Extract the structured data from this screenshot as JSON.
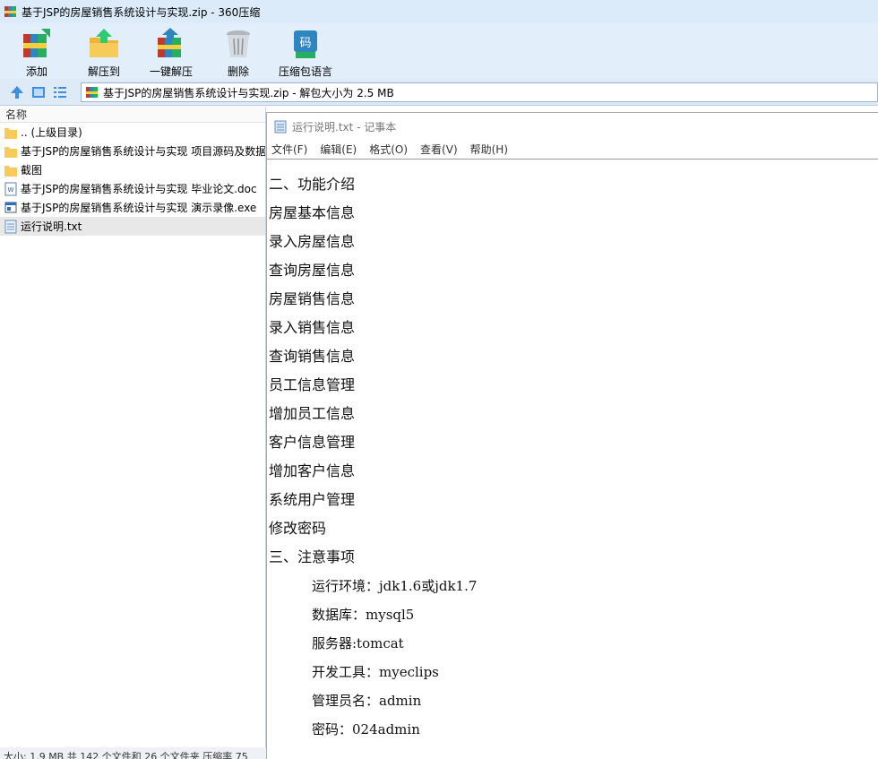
{
  "window": {
    "title": "基于JSP的房屋销售系统设计与实现.zip - 360压缩"
  },
  "toolbar": {
    "buttons": [
      {
        "label": "添加",
        "icon": "add-books-icon"
      },
      {
        "label": "解压到",
        "icon": "extract-to-icon"
      },
      {
        "label": "一键解压",
        "icon": "one-click-extract-icon"
      },
      {
        "label": "删除",
        "icon": "trash-icon"
      },
      {
        "label": "压缩包语言",
        "icon": "archive-language-icon"
      }
    ]
  },
  "address": {
    "text": "基于JSP的房屋销售系统设计与实现.zip - 解包大小为 2.5 MB"
  },
  "filelist": {
    "column_name": "名称",
    "items": [
      {
        "name": ".. (上级目录)",
        "icon": "folder-icon"
      },
      {
        "name": "基于JSP的房屋销售系统设计与实现 项目源码及数据",
        "icon": "folder-icon"
      },
      {
        "name": "截图",
        "icon": "folder-icon"
      },
      {
        "name": "基于JSP的房屋销售系统设计与实现 毕业论文.doc",
        "icon": "word-doc-icon"
      },
      {
        "name": "基于JSP的房屋销售系统设计与实现 演示录像.exe",
        "icon": "exe-icon"
      },
      {
        "name": "运行说明.txt",
        "icon": "text-file-icon",
        "selected": true
      }
    ]
  },
  "status": {
    "text": "大小: 1.9 MB 共 142 个文件和 26 个文件夹 压缩率 75"
  },
  "notepad": {
    "title": "运行说明.txt - 记事本",
    "menu": [
      "文件(F)",
      "编辑(E)",
      "格式(O)",
      "查看(V)",
      "帮助(H)"
    ],
    "lines": [
      "二、功能介绍",
      "房屋基本信息",
      "录入房屋信息",
      "查询房屋信息",
      "房屋销售信息",
      "录入销售信息",
      "查询销售信息",
      "员工信息管理",
      "增加员工信息",
      "客户信息管理",
      "增加客户信息",
      "系统用户管理",
      "修改密码",
      "三、注意事项"
    ],
    "indented_lines": [
      "运行环境：jdk1.6或jdk1.7",
      "数据库：mysql5",
      "服务器:tomcat",
      "开发工具：myeclips",
      "管理员名：admin",
      "密码：024admin"
    ]
  }
}
